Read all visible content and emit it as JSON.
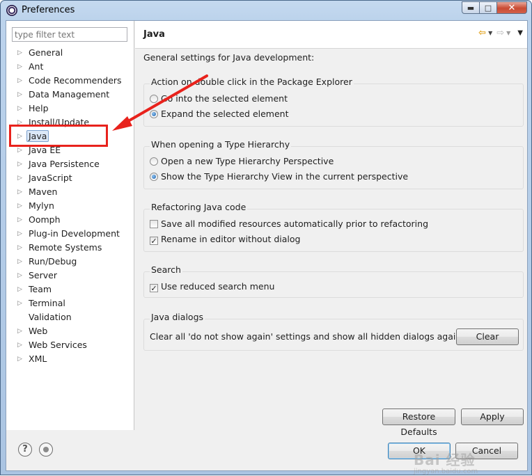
{
  "window": {
    "title": "Preferences",
    "controls": {
      "minimize": "▬",
      "maximize": "□",
      "close": "✕"
    }
  },
  "sidebar": {
    "filter_placeholder": "type filter text",
    "items": [
      {
        "label": "General",
        "expandable": true
      },
      {
        "label": "Ant",
        "expandable": true
      },
      {
        "label": "Code Recommenders",
        "expandable": true
      },
      {
        "label": "Data Management",
        "expandable": true
      },
      {
        "label": "Help",
        "expandable": true
      },
      {
        "label": "Install/Update",
        "expandable": true
      },
      {
        "label": "Java",
        "expandable": true,
        "selected": true
      },
      {
        "label": "Java EE",
        "expandable": true
      },
      {
        "label": "Java Persistence",
        "expandable": true
      },
      {
        "label": "JavaScript",
        "expandable": true
      },
      {
        "label": "Maven",
        "expandable": true
      },
      {
        "label": "Mylyn",
        "expandable": true
      },
      {
        "label": "Oomph",
        "expandable": true
      },
      {
        "label": "Plug-in Development",
        "expandable": true
      },
      {
        "label": "Remote Systems",
        "expandable": true
      },
      {
        "label": "Run/Debug",
        "expandable": true
      },
      {
        "label": "Server",
        "expandable": true
      },
      {
        "label": "Team",
        "expandable": true
      },
      {
        "label": "Terminal",
        "expandable": true
      },
      {
        "label": "Validation",
        "expandable": false
      },
      {
        "label": "Web",
        "expandable": true
      },
      {
        "label": "Web Services",
        "expandable": true
      },
      {
        "label": "XML",
        "expandable": true
      }
    ]
  },
  "page": {
    "title": "Java",
    "description": "General settings for Java development:",
    "groups": {
      "double_click": {
        "title": "Action on double click in the Package Explorer",
        "options": [
          "Go into the selected element",
          "Expand the selected element"
        ],
        "selected_index": 1
      },
      "type_hierarchy": {
        "title": "When opening a Type Hierarchy",
        "options": [
          "Open a new Type Hierarchy Perspective",
          "Show the Type Hierarchy View in the current perspective"
        ],
        "selected_index": 1
      },
      "refactoring": {
        "title": "Refactoring Java code",
        "checks": [
          {
            "label": "Save all modified resources automatically prior to refactoring",
            "checked": false
          },
          {
            "label": "Rename in editor without dialog",
            "checked": true
          }
        ]
      },
      "search": {
        "title": "Search",
        "checks": [
          {
            "label": "Use reduced search menu",
            "checked": true
          }
        ]
      },
      "dialogs": {
        "title": "Java dialogs",
        "text": "Clear all 'do not show again' settings and show all hidden dialogs again",
        "clear_label": "Clear"
      }
    },
    "restore_defaults_label": "Restore Defaults",
    "apply_label": "Apply"
  },
  "footer": {
    "help_icon": "?",
    "ok_label": "OK",
    "cancel_label": "Cancel"
  },
  "watermark": {
    "main": "Bai 经验",
    "sub": "jingyan.baidu.com"
  },
  "colors": {
    "annotation_red": "#e8221c",
    "selection": "#dbe8f7",
    "accent": "#3c7fb1"
  }
}
